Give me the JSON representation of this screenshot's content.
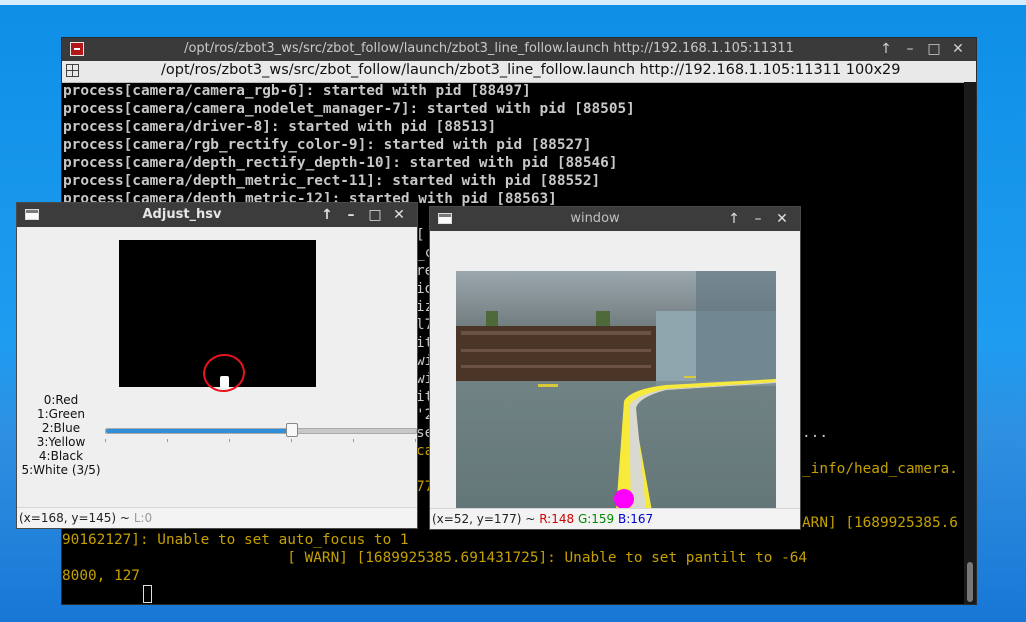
{
  "terminal": {
    "title": "/opt/ros/zbot3_ws/src/zbot_follow/launch/zbot3_line_follow.launch http://192.168.1.105:11311",
    "toolbar_text": "/opt/ros/zbot3_ws/src/zbot_follow/launch/zbot3_line_follow.launch http://192.168.1.105:11311 100x29",
    "lines": [
      "process[camera/camera_rgb-6]: started with pid [88497]",
      "process[camera/camera_nodelet_manager-7]: started with pid [88505]",
      "process[camera/driver-8]: started with pid [88513]",
      "process[camera/rgb_rectify_color-9]: started with pid [88527]",
      "process[camera/depth_rectify_depth-10]: started with pid [88546]",
      "process[camera/depth_metric_rect-11]: started with pid [88552]",
      "process[camera/depth_metric-12]: started with pid [88563]"
    ],
    "frag_dots": "...",
    "frag_head_camera": "_info/head_camera.",
    "frag_warn_right": "ARN] [1689925385.6",
    "warn_line_1": "90162127]: Unable to set auto_focus to 1",
    "warn_line_2": "                          [ WARN] [1689925385.691431725]: Unable to set pantilt to -64",
    "warn_line_3": "8000, 127",
    "left_gap_chars": [
      "[",
      "_c",
      "re",
      "io",
      "iz",
      "l7",
      "it",
      "wi",
      "wi",
      "it",
      "'2",
      "se",
      "ca",
      "",
      "77"
    ]
  },
  "adjust_hsv": {
    "title": "Adjust_hsv",
    "color_options": [
      "0:Red",
      "1:Green",
      "2:Blue",
      "3:Yellow",
      "4:Black",
      "5:White (3/5)"
    ],
    "slider_value": 3,
    "slider_max": 5,
    "status_coords": "(x=168, y=145) ~",
    "status_level": "L:0"
  },
  "window": {
    "title": "window",
    "status_coords": "(x=52, y=177) ~",
    "status_r": "R:148",
    "status_g": "G:159",
    "status_b": "B:167"
  },
  "colors": {
    "terminal_text": "#c8c8c8",
    "warn_text": "#c4a000",
    "slider_accent": "#2f8fd8",
    "annotation_circle": "#e8141e",
    "target_dot": "#ff00ff",
    "line_yellow": "#f7ea3a"
  },
  "icons": {
    "terminal_app": "terminal-app-icon",
    "window_app": "window-app-icon",
    "window_buttons": [
      "up-arrow-icon",
      "minimize-icon",
      "maximize-icon",
      "close-icon"
    ]
  }
}
